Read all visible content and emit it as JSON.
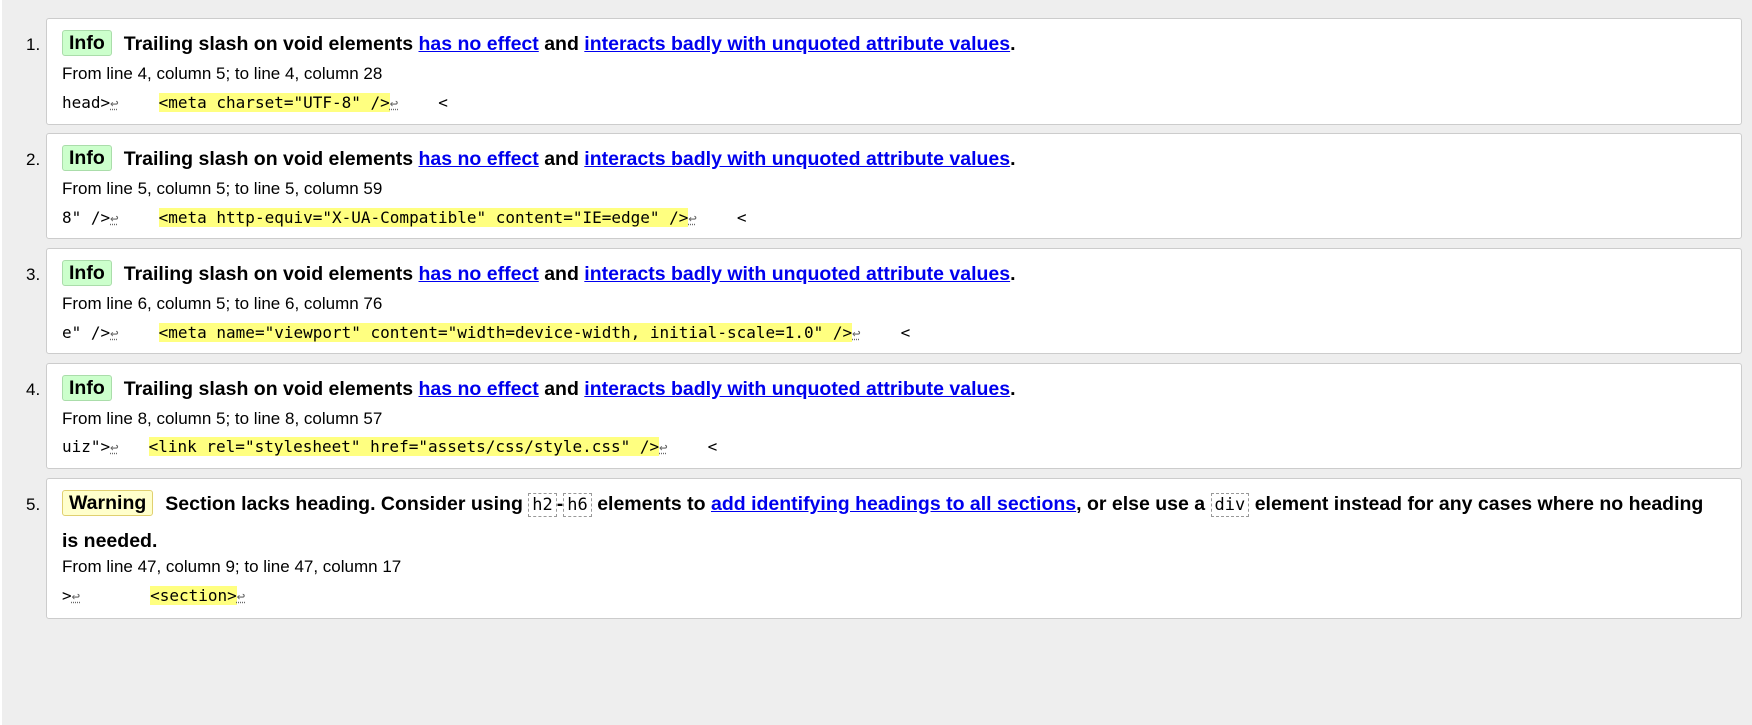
{
  "messages": [
    {
      "number": "1.",
      "type": "Info",
      "title_text": "Trailing slash on void elements",
      "link1": "has no effect",
      "join": "and",
      "link2": "interacts badly with unquoted attribute values",
      "end": ".",
      "location": "From line 4, column 5; to line 4, column 28",
      "extract_before": "head>",
      "lf": "↩",
      "extract_highlight": "<meta charset=\"UTF-8\" />",
      "extract_after": "<"
    },
    {
      "number": "2.",
      "type": "Info",
      "title_text": "Trailing slash on void elements",
      "link1": "has no effect",
      "join": "and",
      "link2": "interacts badly with unquoted attribute values",
      "end": ".",
      "location": "From line 5, column 5; to line 5, column 59",
      "extract_before": "8\" />",
      "lf": "↩",
      "extract_highlight": "<meta http-equiv=\"X-UA-Compatible\" content=\"IE=edge\" />",
      "extract_after": "<"
    },
    {
      "number": "3.",
      "type": "Info",
      "title_text": "Trailing slash on void elements",
      "link1": "has no effect",
      "join": "and",
      "link2": "interacts badly with unquoted attribute values",
      "end": ".",
      "location": "From line 6, column 5; to line 6, column 76",
      "extract_before": "e\" />",
      "lf": "↩",
      "extract_highlight": "<meta name=\"viewport\" content=\"width=device-width, initial-scale=1.0\" />",
      "extract_after": "<"
    },
    {
      "number": "4.",
      "type": "Info",
      "title_text": "Trailing slash on void elements",
      "link1": "has no effect",
      "join": "and",
      "link2": "interacts badly with unquoted attribute values",
      "end": ".",
      "location": "From line 8, column 5; to line 8, column 57",
      "extract_before": "uiz\">",
      "lf": "↩",
      "extract_highlight": "<link rel=\"stylesheet\" href=\"assets/css/style.css\" />",
      "extract_after": "<"
    },
    {
      "number": "5.",
      "type": "Warning",
      "title_part1": "Section lacks heading. Consider using",
      "code1": "h2",
      "dash": "-",
      "code2": "h6",
      "title_part2": "elements to",
      "link1": "add identifying headings to all sections",
      "title_part3": ", or else use a",
      "code3": "div",
      "title_part4": "element instead for any cases where no heading is needed.",
      "location": "From line 47, column 9; to line 47, column 17",
      "extract_before": ">",
      "lf": "↩",
      "extract_highlight": "<section>"
    }
  ],
  "colors": {
    "info_badge": "#ccffcc",
    "warning_badge": "#ffffcc",
    "highlight": "#ffff80",
    "link": "#0000ee"
  }
}
